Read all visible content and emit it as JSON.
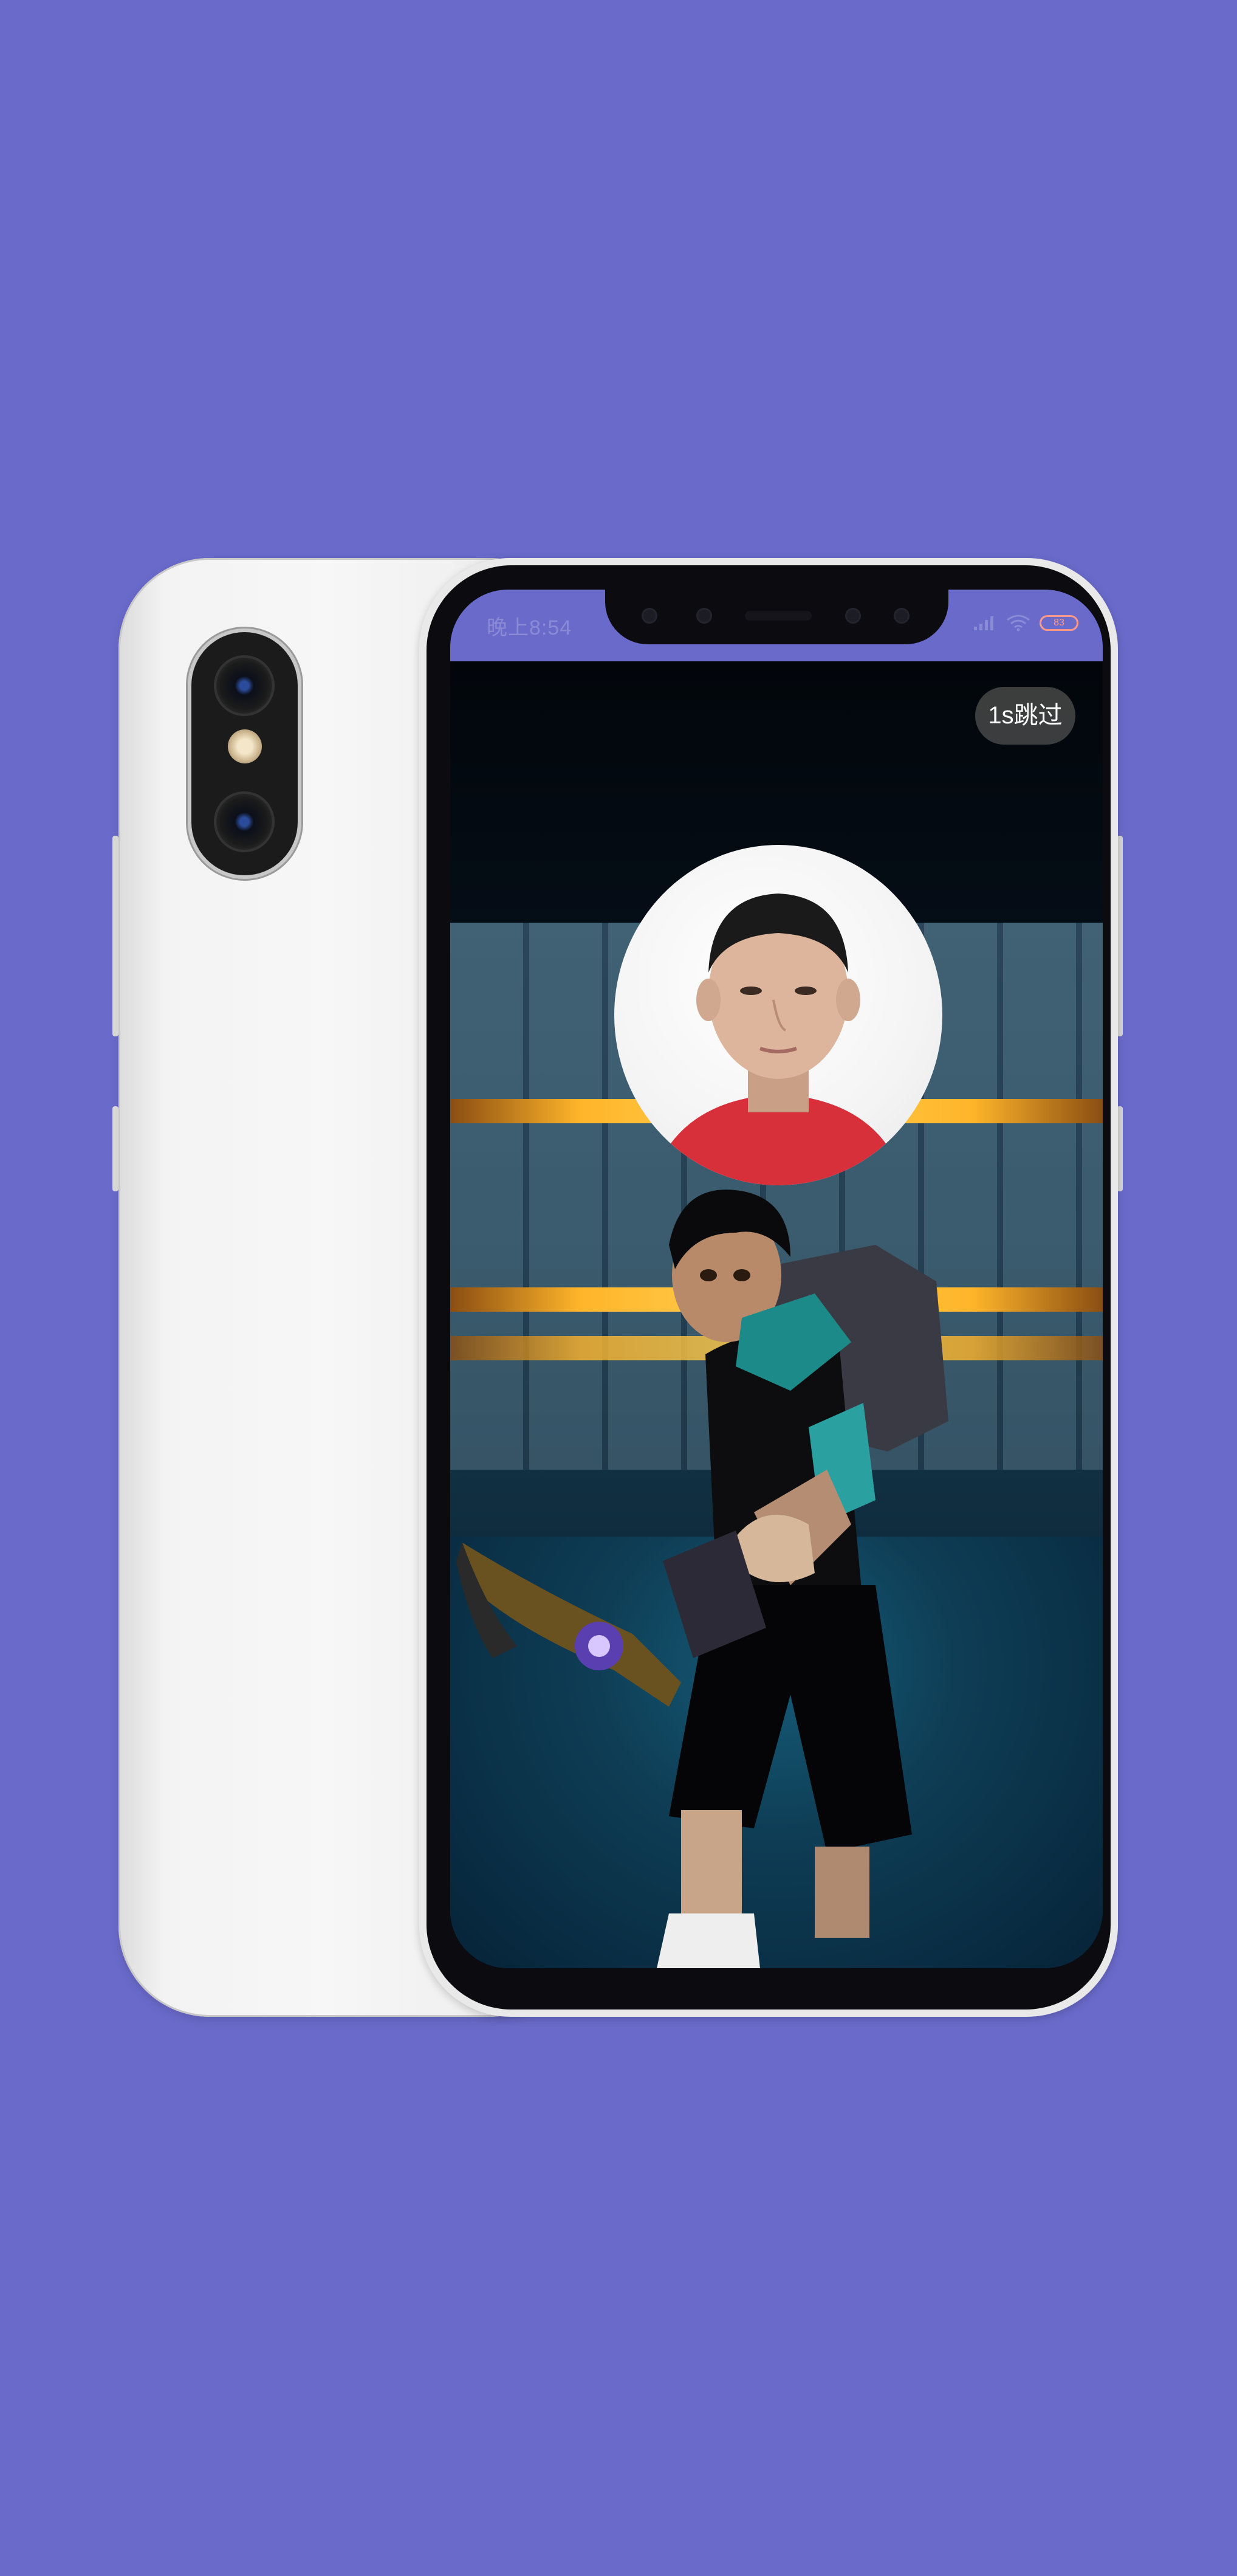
{
  "status_bar": {
    "time": "晚上8:54",
    "battery": "83",
    "icons": [
      "signal-icon",
      "wifi-icon",
      "battery-icon"
    ]
  },
  "splash": {
    "skip_label": "1s跳过",
    "avatar": "user-avatar-photo"
  },
  "colors": {
    "background": "#6a6acb",
    "status_bar": "#6a6acb",
    "skip_button": "#464646"
  }
}
